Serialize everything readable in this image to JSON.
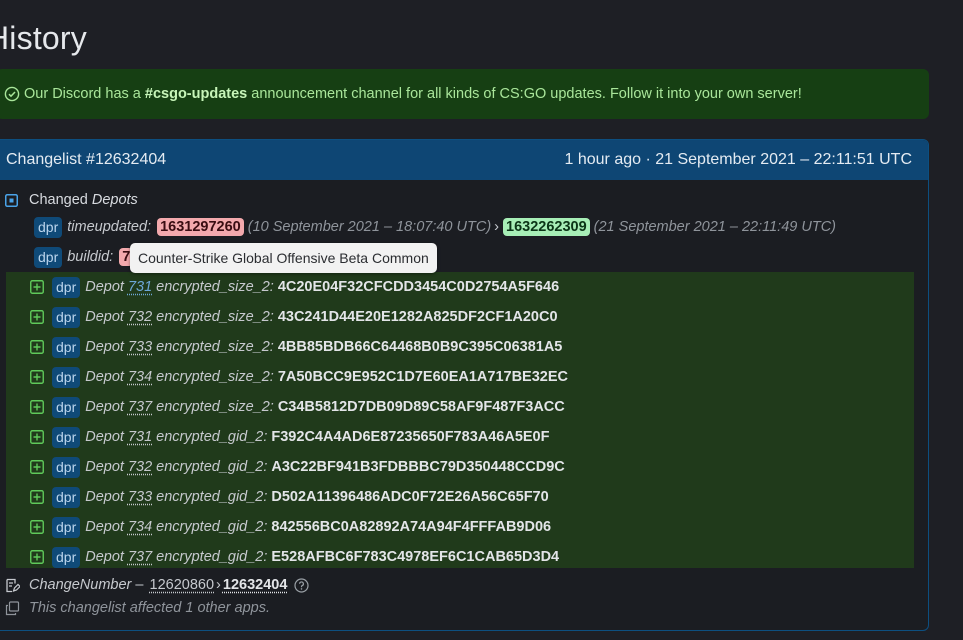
{
  "page": {
    "title": "History"
  },
  "notice": {
    "prefix": "Our Discord has a ",
    "channel": "#csgo-updates",
    "suffix": " announcement channel for all kinds of CS:GO updates. Follow it into your own server!"
  },
  "changelist": {
    "title": "Changelist #12632404",
    "when": "1 hour ago · 21 September 2021 – 22:11:51 UTC",
    "section_label": "Changed",
    "section_label_italic": "Depots",
    "badge": "dpr",
    "timeupdated": {
      "key": "timeupdated:",
      "old_value": "1631297260",
      "old_time": "(10 September 2021 – 18:07:40 UTC)",
      "arrow": "›",
      "new_value": "1632262309",
      "new_time": "(21 September 2021 – 22:11:49 UTC)"
    },
    "buildid": {
      "key": "buildid:",
      "old_value_partial": "7"
    },
    "tooltip": "Counter-Strike Global Offensive Beta Common",
    "depot_word": "Depot",
    "added": [
      {
        "depot": "731",
        "key": "encrypted_size_2:",
        "value": "4C20E04F32CFCDD3454C0D2754A5F646"
      },
      {
        "depot": "732",
        "key": "encrypted_size_2:",
        "value": "43C241D44E20E1282A825DF2CF1A20C0"
      },
      {
        "depot": "733",
        "key": "encrypted_size_2:",
        "value": "4BB85BDB66C64468B0B9C395C06381A5"
      },
      {
        "depot": "734",
        "key": "encrypted_size_2:",
        "value": "7A50BCC9E952C1D7E60EA1A717BE32EC"
      },
      {
        "depot": "737",
        "key": "encrypted_size_2:",
        "value": "C34B5812D7DB09D89C58AF9F487F3ACC"
      },
      {
        "depot": "731",
        "key": "encrypted_gid_2:",
        "value": "F392C4A4AD6E87235650F783A46A5E0F"
      },
      {
        "depot": "732",
        "key": "encrypted_gid_2:",
        "value": "A3C22BF941B3FDBBBC79D350448CCD9C"
      },
      {
        "depot": "733",
        "key": "encrypted_gid_2:",
        "value": "D502A11396486ADC0F72E26A56C65F70"
      },
      {
        "depot": "734",
        "key": "encrypted_gid_2:",
        "value": "842556BC0A82892A74A94F4FFFAB9D06"
      },
      {
        "depot": "737",
        "key": "encrypted_gid_2:",
        "value": "E528AFBC6F783C4978EF6C1CAB65D3D4"
      }
    ],
    "change_number": {
      "label": "ChangeNumber",
      "sep": "–",
      "old": "12620860",
      "arrow": "›",
      "new": "12632404"
    },
    "affected": "This changelist affected 1 other apps."
  },
  "colors": {
    "accent": "#0e4674",
    "notice_bg": "#163f13",
    "added_bg": "#203a1b",
    "old_value_bg": "#f3a9ad",
    "new_value_bg": "#a7eeb6"
  }
}
